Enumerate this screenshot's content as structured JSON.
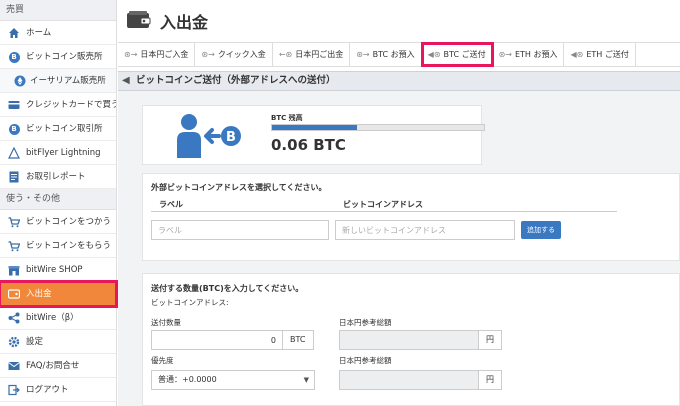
{
  "sidebar": {
    "section_trade": "売買",
    "items_trade": [
      {
        "label": "ホーム",
        "icon": "home-icon"
      },
      {
        "label": "ビットコイン販売所",
        "icon": "bitcoin-icon"
      },
      {
        "label": "イーサリアム販売所",
        "icon": "ethereum-icon"
      },
      {
        "label": "クレジットカードで買う",
        "icon": "credit-card-icon"
      },
      {
        "label": "ビットコイン取引所",
        "icon": "bitcoin-icon"
      },
      {
        "label": "bitFlyer Lightning",
        "icon": "lightning-icon"
      },
      {
        "label": "お取引レポート",
        "icon": "report-icon"
      }
    ],
    "section_use": "使う・その他",
    "items_use": [
      {
        "label": "ビットコインをつかう",
        "icon": "cart-icon"
      },
      {
        "label": "ビットコインをもらう",
        "icon": "cart-icon"
      },
      {
        "label": "bitWire SHOP",
        "icon": "shop-icon"
      },
      {
        "label": "入出金",
        "icon": "wallet-icon"
      },
      {
        "label": "bitWire（β）",
        "icon": "share-icon"
      },
      {
        "label": "設定",
        "icon": "gear-icon"
      },
      {
        "label": "FAQ/お問合せ",
        "icon": "mail-icon"
      },
      {
        "label": "ログアウト",
        "icon": "logout-icon"
      }
    ]
  },
  "page": {
    "title": "入出金",
    "tabs": [
      {
        "label": "日本円ご入金",
        "icon": "yen-in-icon"
      },
      {
        "label": "クイック入金",
        "icon": "quick-icon"
      },
      {
        "label": "日本円ご出金",
        "icon": "yen-out-icon"
      },
      {
        "label": "BTC お預入",
        "icon": "btc-in-icon"
      },
      {
        "label": "BTC ご送付",
        "icon": "btc-send-icon"
      },
      {
        "label": "ETH お預入",
        "icon": "eth-in-icon"
      },
      {
        "label": "ETH ご送付",
        "icon": "eth-send-icon"
      }
    ],
    "section_title": "ビットコインご送付（外部アドレスへの送付）",
    "balance": {
      "label": "BTC 残高",
      "value": "0.06 BTC",
      "fill_fraction": 0.4
    },
    "address": {
      "title": "外部ビットコインアドレスを選択してください。",
      "col_label": "ラベル",
      "col_address": "ビットコインアドレス",
      "label_placeholder": "ラベル",
      "address_placeholder": "新しいビットコインアドレス",
      "add_button": "追加する"
    },
    "amount": {
      "title": "送付する数量(BTC)を入力してください。",
      "subtitle": "ビットコインアドレス:",
      "qty_label": "送付数量",
      "qty_value": "0",
      "qty_unit": "BTC",
      "jpy_label": "日本円参考総額",
      "jpy_unit": "円",
      "priority_label": "優先度",
      "priority_value": "普通：+0.0000",
      "jpy_label2": "日本円参考総額",
      "jpy_unit2": "円"
    }
  },
  "colors": {
    "accent_blue": "#3a78c2",
    "active_orange": "#f0873a",
    "highlight_pink": "#e8175d"
  }
}
